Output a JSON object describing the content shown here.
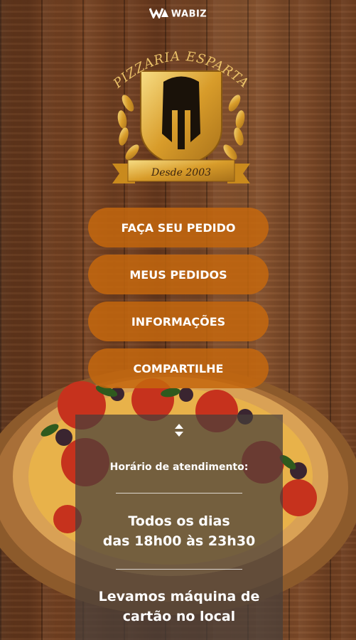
{
  "brand": {
    "name": "WABIZ",
    "icon": "wabiz-logo-icon"
  },
  "logo": {
    "name": "PIZZARIA ESPARTA",
    "since": "Desde 2003",
    "icon": "spartan-helmet-shield-icon"
  },
  "menu": {
    "order": "FAÇA SEU PEDIDO",
    "my_orders": "MEUS PEDIDOS",
    "info": "INFORMAÇÕES",
    "share": "COMPARTILHE"
  },
  "info_panel": {
    "arrows_icon": "expand-arrows-icon",
    "label": "Horário de atendimento:",
    "days": "Todos os dias",
    "hours": "das 18h00 às 23h30",
    "card_line1": "Levamos máquina de",
    "card_line2": "cartão no local"
  },
  "colors": {
    "button": "#C4670E",
    "gold": "#E8B63A",
    "panel": "#463E3A"
  }
}
